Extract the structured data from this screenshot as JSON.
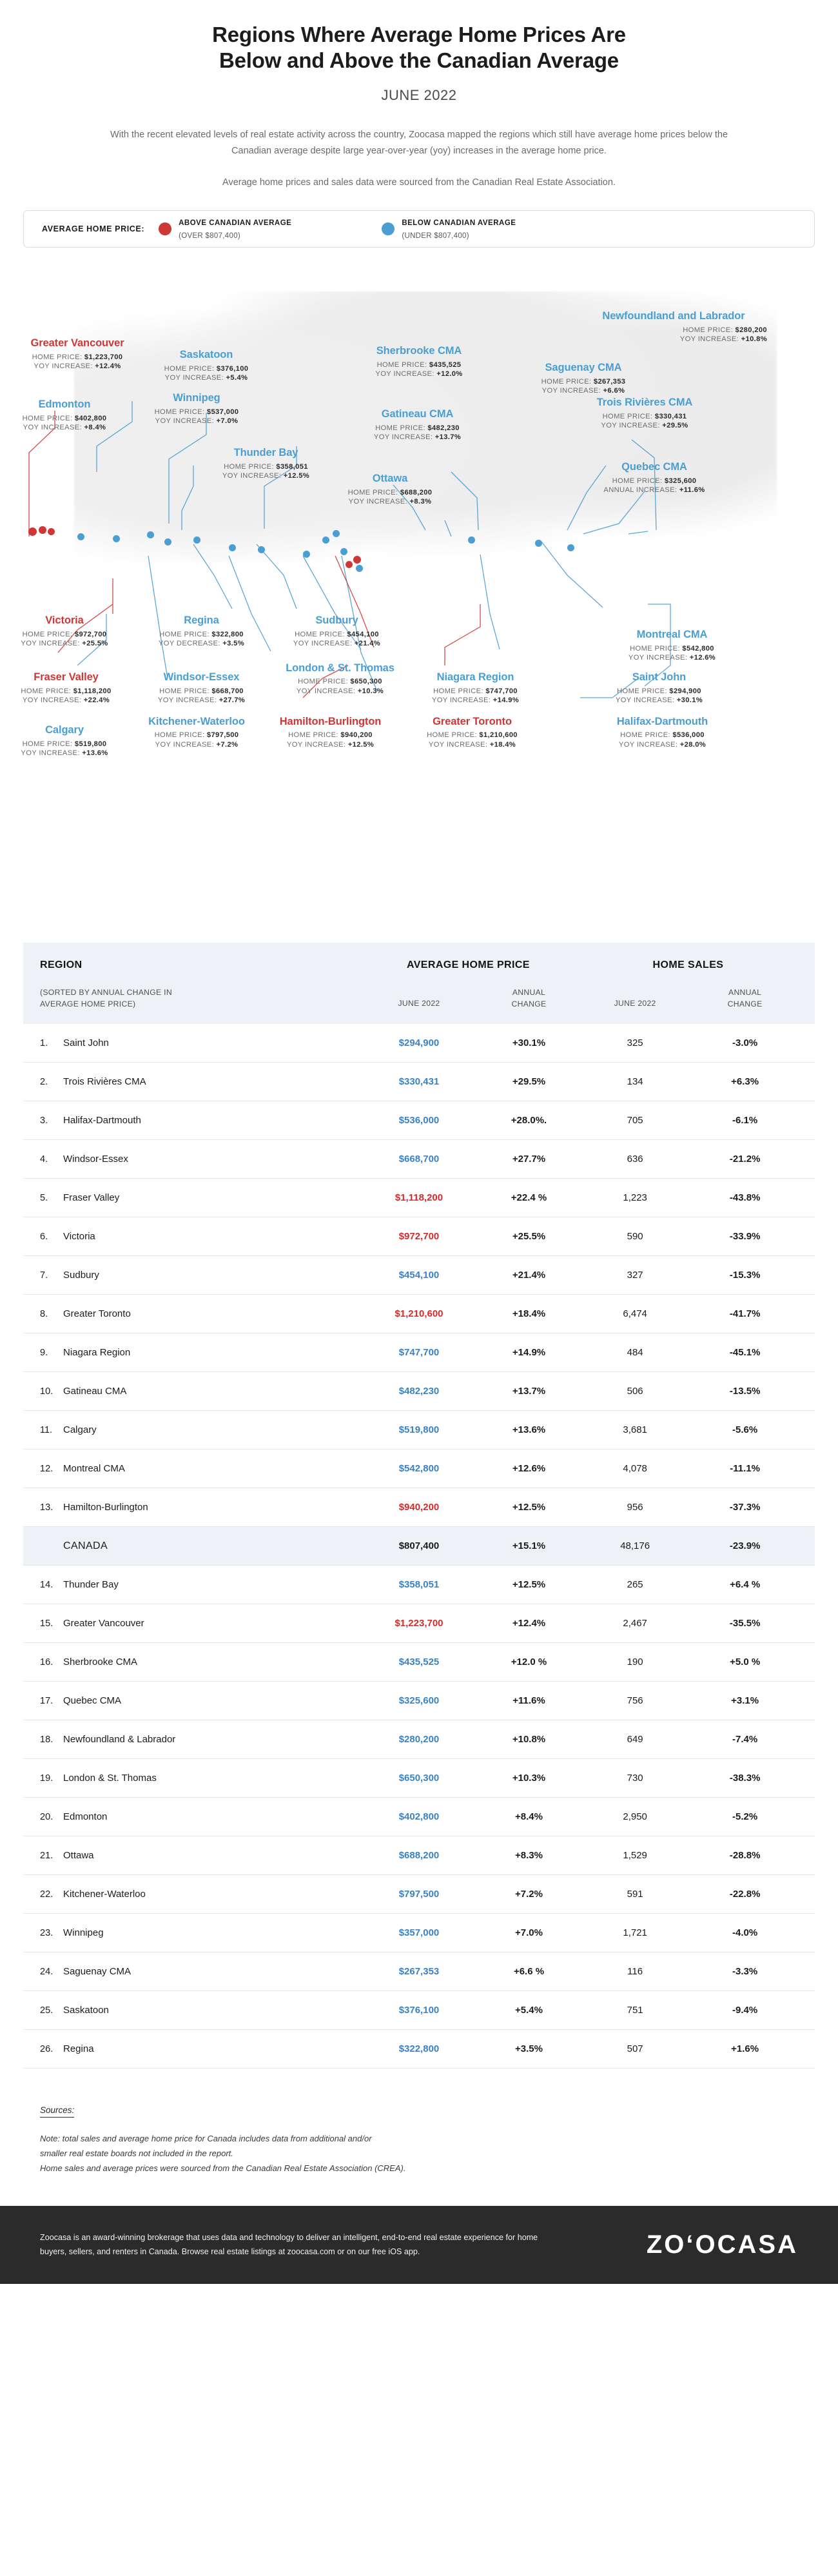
{
  "header": {
    "title_line1": "Regions Where Average Home Prices Are",
    "title_line2": "Below and Above the Canadian Average",
    "subtitle": "JUNE 2022",
    "intro": "With the recent elevated levels of real estate activity across the country, Zoocasa mapped the regions which still have average home prices below the Canadian average despite large year-over-year (yoy) increases in the average home price.",
    "intro2": "Average home prices and sales data were sourced from the Canadian Real Estate Association."
  },
  "legend": {
    "title": "AVERAGE HOME PRICE:",
    "above_label": "ABOVE CANADIAN AVERAGE",
    "above_sub": "(OVER $807,400)",
    "below_label": "BELOW CANADIAN AVERAGE",
    "below_sub": "(UNDER $807,400)",
    "above_color": "#cf3736",
    "below_color": "#4b9ed1"
  },
  "map": {
    "callouts": [
      {
        "name": "Greater Vancouver",
        "price_label": "HOME PRICE:",
        "price": "$1,223,700",
        "chg_label": "YOY INCREASE:",
        "chg": "+12.4%",
        "kind": "red"
      },
      {
        "name": "Saskatoon",
        "price_label": "HOME PRICE:",
        "price": "$376,100",
        "chg_label": "YOY INCREASE:",
        "chg": "+5.4%",
        "kind": "blue"
      },
      {
        "name": "Sherbrooke CMA",
        "price_label": "HOME PRICE:",
        "price": "$435,525",
        "chg_label": "YOY INCREASE:",
        "chg": "+12.0%",
        "kind": "blue"
      },
      {
        "name": "Newfoundland and Labrador",
        "price_label": "HOME PRICE:",
        "price": "$280,200",
        "chg_label": "YOY INCREASE:",
        "chg": "+10.8%",
        "kind": "blue"
      },
      {
        "name": "Edmonton",
        "price_label": "HOME PRICE:",
        "price": "$402,800",
        "chg_label": "YOY INCREASE:",
        "chg": "+8.4%",
        "kind": "blue"
      },
      {
        "name": "Winnipeg",
        "price_label": "HOME PRICE:",
        "price": "$537,000",
        "chg_label": "YOY INCREASE:",
        "chg": "+7.0%",
        "kind": "blue"
      },
      {
        "name": "Saguenay CMA",
        "price_label": "HOME PRICE:",
        "price": "$267,353",
        "chg_label": "YOY INCREASE:",
        "chg": "+6.6%",
        "kind": "blue"
      },
      {
        "name": "Trois Rivières CMA",
        "price_label": "HOME PRICE:",
        "price": "$330,431",
        "chg_label": "YOY INCREASE:",
        "chg": "+29.5%",
        "kind": "blue"
      },
      {
        "name": "Gatineau CMA",
        "price_label": "HOME PRICE:",
        "price": "$482,230",
        "chg_label": "YOY INCREASE:",
        "chg": "+13.7%",
        "kind": "blue"
      },
      {
        "name": "Thunder Bay",
        "price_label": "HOME PRICE:",
        "price": "$358,051",
        "chg_label": "YOY INCREASE:",
        "chg": "+12.5%",
        "kind": "blue"
      },
      {
        "name": "Ottawa",
        "price_label": "HOME PRICE:",
        "price": "$688,200",
        "chg_label": "YOY INCREASE:",
        "chg": "+8.3%",
        "kind": "blue"
      },
      {
        "name": "Quebec CMA",
        "price_label": "HOME PRICE:",
        "price": "$325,600",
        "chg_label": "ANNUAL INCREASE:",
        "chg": "+11.6%",
        "kind": "blue"
      },
      {
        "name": "Victoria",
        "price_label": "HOME PRICE:",
        "price": "$972,700",
        "chg_label": "YOY INCREASE:",
        "chg": "+25.5%",
        "kind": "red"
      },
      {
        "name": "Regina",
        "price_label": "HOME PRICE:",
        "price": "$322,800",
        "chg_label": "YOY DECREASE:",
        "chg": "+3.5%",
        "kind": "blue"
      },
      {
        "name": "Sudbury",
        "price_label": "HOME PRICE:",
        "price": "$454,100",
        "chg_label": "YOY INCREASE:",
        "chg": "+21.4%",
        "kind": "blue"
      },
      {
        "name": "Montreal CMA",
        "price_label": "HOME PRICE:",
        "price": "$542,800",
        "chg_label": "YOY INCREASE:",
        "chg": "+12.6%",
        "kind": "blue"
      },
      {
        "name": "Fraser Valley",
        "price_label": "HOME PRICE:",
        "price": "$1,118,200",
        "chg_label": "YOY INCREASE:",
        "chg": "+22.4%",
        "kind": "red"
      },
      {
        "name": "Windsor-Essex",
        "price_label": "HOME PRICE:",
        "price": "$668,700",
        "chg_label": "YOY INCREASE:",
        "chg": "+27.7%",
        "kind": "blue"
      },
      {
        "name": "London & St. Thomas",
        "price_label": "HOME PRICE:",
        "price": "$650,300",
        "chg_label": "YOY INCREASE:",
        "chg": "+10.3%",
        "kind": "blue"
      },
      {
        "name": "Niagara Region",
        "price_label": "HOME PRICE:",
        "price": "$747,700",
        "chg_label": "YOY INCREASE:",
        "chg": "+14.9%",
        "kind": "blue"
      },
      {
        "name": "Saint John",
        "price_label": "HOME PRICE:",
        "price": "$294,900",
        "chg_label": "YOY INCREASE:",
        "chg": "+30.1%",
        "kind": "blue"
      },
      {
        "name": "Calgary",
        "price_label": "HOME PRICE:",
        "price": "$519,800",
        "chg_label": "YOY INCREASE:",
        "chg": "+13.6%",
        "kind": "blue"
      },
      {
        "name": "Kitchener-Waterloo",
        "price_label": "HOME PRICE:",
        "price": "$797,500",
        "chg_label": "YOY INCREASE:",
        "chg": "+7.2%",
        "kind": "blue"
      },
      {
        "name": "Hamilton-Burlington",
        "price_label": "HOME PRICE:",
        "price": "$940,200",
        "chg_label": "YOY INCREASE:",
        "chg": "+12.5%",
        "kind": "red"
      },
      {
        "name": "Greater Toronto",
        "price_label": "HOME PRICE:",
        "price": "$1,210,600",
        "chg_label": "YOY INCREASE:",
        "chg": "+18.4%",
        "kind": "red"
      },
      {
        "name": "Halifax-Dartmouth",
        "price_label": "HOME PRICE:",
        "price": "$536,000",
        "chg_label": "YOY INCREASE:",
        "chg": "+28.0%",
        "kind": "blue"
      }
    ]
  },
  "table": {
    "headers": {
      "region": "REGION",
      "region_sub_line1": "(SORTED BY ANNUAL CHANGE IN",
      "region_sub_line2": "AVERAGE HOME PRICE)",
      "avg_price": "AVERAGE HOME PRICE",
      "home_sales": "HOME SALES",
      "price_period": "JUNE 2022",
      "price_change_l1": "ANNUAL",
      "price_change_l2": "CHANGE",
      "sales_period": "JUNE 2022",
      "sales_change_l1": "ANNUAL",
      "sales_change_l2": "CHANGE"
    },
    "rows": [
      {
        "rank": "1.",
        "region": "Saint John",
        "price": "$294,900",
        "price_color": "blue",
        "price_change": "+30.1%",
        "sales": "325",
        "sales_change": "-3.0%"
      },
      {
        "rank": "2.",
        "region": "Trois Rivières CMA",
        "price": "$330,431",
        "price_color": "blue",
        "price_change": "+29.5%",
        "sales": "134",
        "sales_change": "+6.3%"
      },
      {
        "rank": "3.",
        "region": "Halifax-Dartmouth",
        "price": "$536,000",
        "price_color": "blue",
        "price_change": "+28.0%.",
        "sales": "705",
        "sales_change": "-6.1%"
      },
      {
        "rank": "4.",
        "region": "Windsor-Essex",
        "price": "$668,700",
        "price_color": "blue",
        "price_change": "+27.7%",
        "sales": "636",
        "sales_change": "-21.2%"
      },
      {
        "rank": "5.",
        "region": "Fraser Valley",
        "price": "$1,118,200",
        "price_color": "red",
        "price_change": "+22.4 %",
        "sales": "1,223",
        "sales_change": "-43.8%"
      },
      {
        "rank": "6.",
        "region": "Victoria",
        "price": "$972,700",
        "price_color": "red",
        "price_change": "+25.5%",
        "sales": "590",
        "sales_change": "-33.9%"
      },
      {
        "rank": "7.",
        "region": "Sudbury",
        "price": "$454,100",
        "price_color": "blue",
        "price_change": "+21.4%",
        "sales": "327",
        "sales_change": "-15.3%"
      },
      {
        "rank": "8.",
        "region": "Greater Toronto",
        "price": "$1,210,600",
        "price_color": "red",
        "price_change": "+18.4%",
        "sales": "6,474",
        "sales_change": "-41.7%"
      },
      {
        "rank": "9.",
        "region": "Niagara Region",
        "price": "$747,700",
        "price_color": "blue",
        "price_change": "+14.9%",
        "sales": "484",
        "sales_change": "-45.1%"
      },
      {
        "rank": "10.",
        "region": "Gatineau CMA",
        "price": "$482,230",
        "price_color": "blue",
        "price_change": "+13.7%",
        "sales": "506",
        "sales_change": "-13.5%"
      },
      {
        "rank": "11.",
        "region": "Calgary",
        "price": "$519,800",
        "price_color": "blue",
        "price_change": "+13.6%",
        "sales": "3,681",
        "sales_change": "-5.6%"
      },
      {
        "rank": "12.",
        "region": "Montreal CMA",
        "price": "$542,800",
        "price_color": "blue",
        "price_change": "+12.6%",
        "sales": "4,078",
        "sales_change": "-11.1%"
      },
      {
        "rank": "13.",
        "region": "Hamilton-Burlington",
        "price": "$940,200",
        "price_color": "red",
        "price_change": "+12.5%",
        "sales": "956",
        "sales_change": "-37.3%"
      },
      {
        "rank": "",
        "region": "CANADA",
        "price": "$807,400",
        "price_color": "dark",
        "price_change": "+15.1%",
        "sales": "48,176",
        "sales_change": "-23.9%",
        "is_canada": true
      },
      {
        "rank": "14.",
        "region": "Thunder Bay",
        "price": "$358,051",
        "price_color": "blue",
        "price_change": "+12.5%",
        "sales": "265",
        "sales_change": "+6.4 %"
      },
      {
        "rank": "15.",
        "region": "Greater Vancouver",
        "price": "$1,223,700",
        "price_color": "red",
        "price_change": "+12.4%",
        "sales": "2,467",
        "sales_change": "-35.5%"
      },
      {
        "rank": "16.",
        "region": "Sherbrooke CMA",
        "price": "$435,525",
        "price_color": "blue",
        "price_change": "+12.0 %",
        "sales": "190",
        "sales_change": "+5.0 %"
      },
      {
        "rank": "17.",
        "region": "Quebec CMA",
        "price": "$325,600",
        "price_color": "blue",
        "price_change": "+11.6%",
        "sales": "756",
        "sales_change": "+3.1%"
      },
      {
        "rank": "18.",
        "region": "Newfoundland & Labrador",
        "price": "$280,200",
        "price_color": "blue",
        "price_change": "+10.8%",
        "sales": "649",
        "sales_change": "-7.4%"
      },
      {
        "rank": "19.",
        "region": "London & St. Thomas",
        "price": "$650,300",
        "price_color": "blue",
        "price_change": "+10.3%",
        "sales": "730",
        "sales_change": "-38.3%"
      },
      {
        "rank": "20.",
        "region": "Edmonton",
        "price": "$402,800",
        "price_color": "blue",
        "price_change": "+8.4%",
        "sales": "2,950",
        "sales_change": "-5.2%"
      },
      {
        "rank": "21.",
        "region": "Ottawa",
        "price": "$688,200",
        "price_color": "blue",
        "price_change": "+8.3%",
        "sales": "1,529",
        "sales_change": "-28.8%"
      },
      {
        "rank": "22.",
        "region": "Kitchener-Waterloo",
        "price": "$797,500",
        "price_color": "blue",
        "price_change": "+7.2%",
        "sales": "591",
        "sales_change": "-22.8%"
      },
      {
        "rank": "23.",
        "region": "Winnipeg",
        "price": "$357,000",
        "price_color": "blue",
        "price_change": "+7.0%",
        "sales": "1,721",
        "sales_change": "-4.0%"
      },
      {
        "rank": "24.",
        "region": "Saguenay CMA",
        "price": "$267,353",
        "price_color": "blue",
        "price_change": "+6.6 %",
        "sales": "116",
        "sales_change": "-3.3%"
      },
      {
        "rank": "25.",
        "region": "Saskatoon",
        "price": "$376,100",
        "price_color": "blue",
        "price_change": "+5.4%",
        "sales": "751",
        "sales_change": "-9.4%"
      },
      {
        "rank": "26.",
        "region": "Regina",
        "price": "$322,800",
        "price_color": "blue",
        "price_change": "+3.5%",
        "sales": "507",
        "sales_change": "+1.6%"
      }
    ]
  },
  "sources": {
    "title": "Sources:",
    "note_line1": "Note: total sales and average home price for Canada includes data from additional and/or",
    "note_line2": "smaller real estate boards not included in the report.",
    "note_line3": "Home sales and average prices were sourced from the Canadian Real Estate Association (CREA)."
  },
  "footer": {
    "text": "Zoocasa is an award-winning brokerage that uses data and technology to deliver an intelligent, end-to-end real estate experience for home buyers, sellers, and renters in Canada. Browse real estate listings at zoocasa.com or on our free iOS app.",
    "logo": "ZO‘OCASA"
  }
}
